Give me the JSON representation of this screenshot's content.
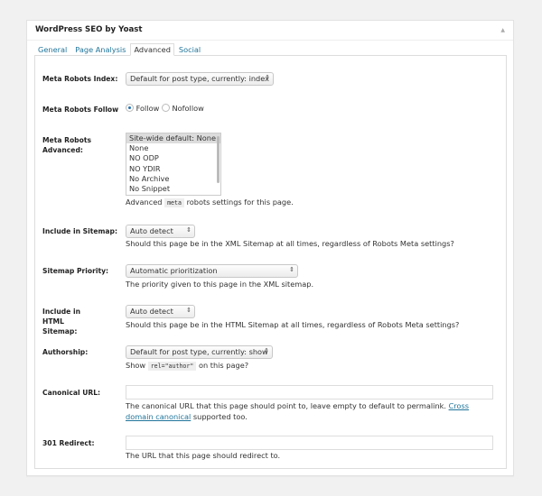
{
  "title": "WordPress SEO by Yoast",
  "tabs": [
    "General",
    "Page Analysis",
    "Advanced",
    "Social"
  ],
  "meta_index": {
    "label": "Meta Robots Index:",
    "value": "Default for post type, currently: index"
  },
  "meta_follow": {
    "label": "Meta Robots Follow",
    "options": [
      "Follow",
      "Nofollow"
    ],
    "selected": "Follow"
  },
  "meta_advanced": {
    "label": "Meta Robots Advanced:",
    "options": [
      "Site-wide default: None",
      "None",
      "NO ODP",
      "NO YDIR",
      "No Archive",
      "No Snippet"
    ],
    "help_pre": "Advanced",
    "help_code": "meta",
    "help_post": "robots settings for this page."
  },
  "sitemap": {
    "label": "Include in Sitemap:",
    "value": "Auto detect",
    "help": "Should this page be in the XML Sitemap at all times, regardless of Robots Meta settings?"
  },
  "priority": {
    "label": "Sitemap Priority:",
    "value": "Automatic prioritization",
    "help": "The priority given to this page in the XML sitemap."
  },
  "html_sitemap": {
    "label": "Include in HTML Sitemap:",
    "value": "Auto detect",
    "help": "Should this page be in the HTML Sitemap at all times, regardless of Robots Meta settings?"
  },
  "authorship": {
    "label": "Authorship:",
    "value": "Default for post type, currently: show",
    "help_pre": "Show",
    "help_code": "rel=\"author\"",
    "help_post": "on this page?"
  },
  "canonical": {
    "label": "Canonical URL:",
    "value": "",
    "help": "The canonical URL that this page should point to, leave empty to default to permalink.",
    "link": "Cross domain canonical",
    "help_post": "supported too."
  },
  "redirect": {
    "label": "301 Redirect:",
    "value": "",
    "help": "The URL that this page should redirect to."
  }
}
